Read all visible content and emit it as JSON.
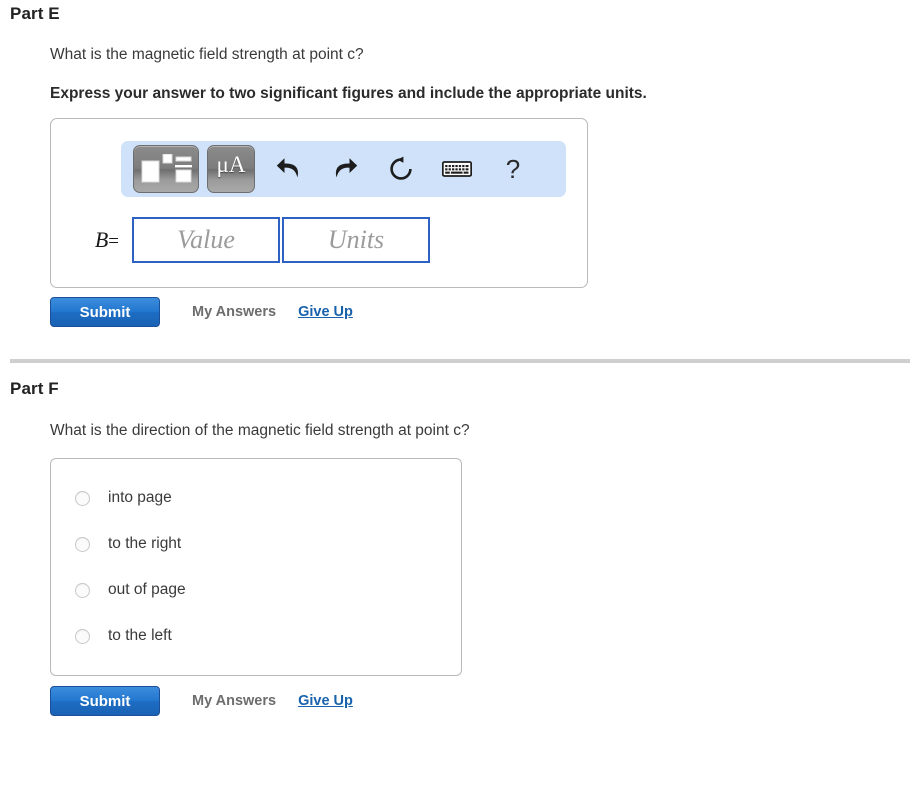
{
  "parts": [
    {
      "title": "Part E",
      "question": "What is the magnetic field strength at point c?",
      "instruction": "Express your answer to two significant figures and include the appropriate units.",
      "toolbar": {
        "template_icon": "math-template-icon",
        "units_label": "μA",
        "undo_icon": "undo-arrow-icon",
        "redo_icon": "redo-arrow-icon",
        "reset_icon": "reset-circular-arrow-icon",
        "keyboard_icon": "keyboard-icon",
        "help_label": "?"
      },
      "input": {
        "variable": "B",
        "equals": "=",
        "value_placeholder": "Value",
        "units_placeholder": "Units",
        "value": "",
        "units": ""
      },
      "actions": {
        "submit_label": "Submit",
        "my_answers_label": "My Answers",
        "give_up_label": "Give Up"
      }
    },
    {
      "title": "Part F",
      "question": "What is the direction of the magnetic field strength at point c?",
      "choices": [
        {
          "label": "into page",
          "selected": false
        },
        {
          "label": "to the right",
          "selected": false
        },
        {
          "label": "out of page",
          "selected": false
        },
        {
          "label": "to the left",
          "selected": false
        }
      ],
      "actions": {
        "submit_label": "Submit",
        "my_answers_label": "My Answers",
        "give_up_label": "Give Up"
      }
    }
  ],
  "colors": {
    "toolbar_bg": "#cfe2f9",
    "field_border": "#2d62c4",
    "submit_blue": "#2176cf",
    "link_blue": "#1862ad",
    "separator": "#cfcfcf",
    "box_border": "#b9b9b9"
  }
}
